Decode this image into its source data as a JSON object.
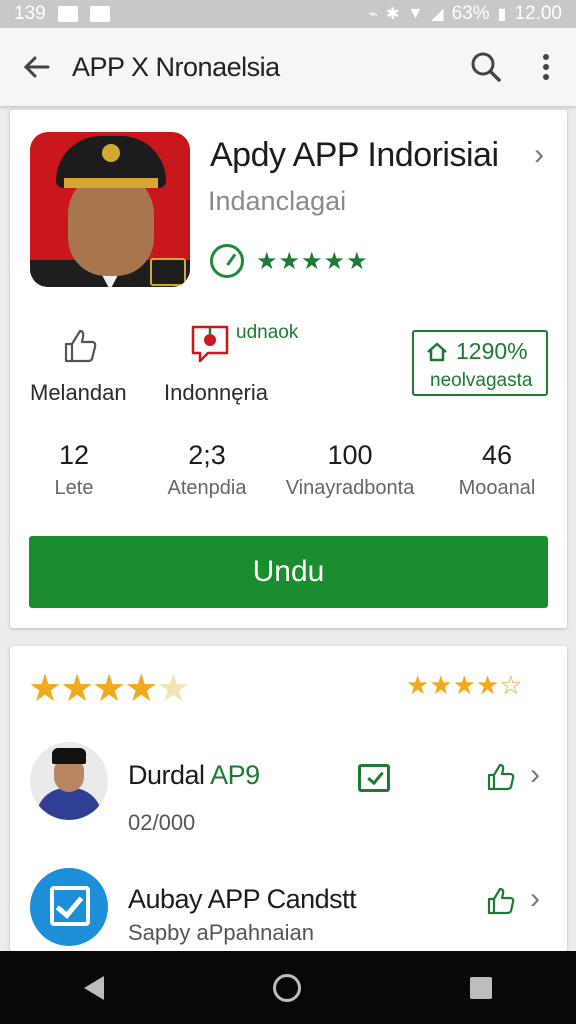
{
  "status_bar": {
    "time_left": "139",
    "battery_text": "63%",
    "clock": "12.00"
  },
  "app_bar": {
    "title": "APP X Nronaelsia"
  },
  "app": {
    "name": "Apdy APP Indorisiai",
    "developer": "Indanclagai",
    "rating_stars": 5
  },
  "features": [
    {
      "label": "Melandan",
      "icon": "thumbs-up-icon"
    },
    {
      "label": "Indonnęria",
      "icon": "flag-chat-icon",
      "tag": "udnaok"
    },
    {
      "label": "neolvagasta",
      "icon": "home-icon",
      "value": "1290%"
    }
  ],
  "stats": [
    {
      "value": "12",
      "label": "Lete"
    },
    {
      "value": "2;3",
      "label": "Atenpdia"
    },
    {
      "value": "100",
      "label": "Vinayradbonta"
    },
    {
      "value": "46",
      "label": "Mooanal"
    }
  ],
  "install_button": {
    "label": "Undu"
  },
  "reviews_section": {
    "overall_stars": 3.5,
    "average_stars": 4.5
  },
  "reviews": [
    {
      "name": "Durdal",
      "name_accent": "AP9",
      "subtitle": "02/000",
      "avatar": "person-avatar"
    },
    {
      "name": "Aubay APP",
      "name_accent": "Candstt",
      "subtitle": "Sapby aPpahnaian",
      "avatar": "checkbox-avatar"
    }
  ],
  "colors": {
    "primary_green": "#1a8e2e",
    "accent_green": "#1d7a34",
    "star_gold": "#f2a91c",
    "nav_bar": "#080808"
  }
}
